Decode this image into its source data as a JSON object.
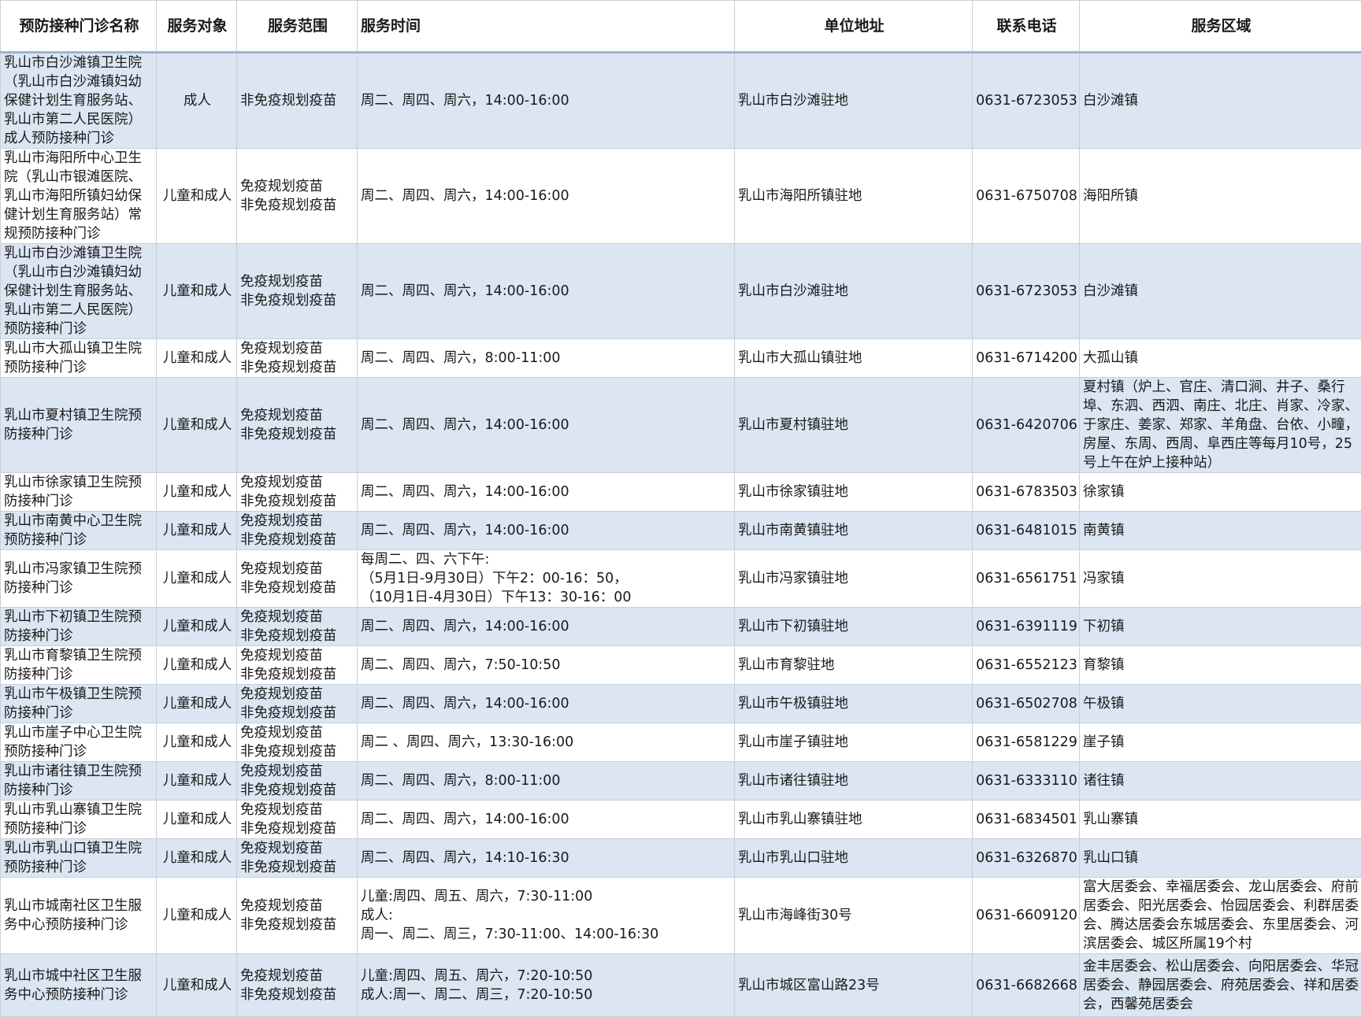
{
  "headers": {
    "name": "预防接种门诊名称",
    "target": "服务对象",
    "scope": "服务范围",
    "time": "服务时间",
    "address": "单位地址",
    "phone": "联系电话",
    "area": "服务区域"
  },
  "rows": [
    {
      "name": "乳山市白沙滩镇卫生院（乳山市白沙滩镇妇幼保健计划生育服务站、乳山市第二人民医院）成人预防接种门诊",
      "target": "成人",
      "scope": "非免疫规划疫苗",
      "time": "周二、周四、周六，14:00-16:00",
      "address": "乳山市白沙滩驻地",
      "phone": "0631-6723053",
      "area": "白沙滩镇"
    },
    {
      "name": "乳山市海阳所中心卫生院（乳山市银滩医院、乳山市海阳所镇妇幼保健计划生育服务站）常规预防接种门诊",
      "target": "儿童和成人",
      "scope": "免疫规划疫苗\n非免疫规划疫苗",
      "time": "周二、周四、周六，14:00-16:00",
      "address": "乳山市海阳所镇驻地",
      "phone": "0631-6750708",
      "area": "海阳所镇"
    },
    {
      "name": "乳山市白沙滩镇卫生院（乳山市白沙滩镇妇幼保健计划生育服务站、乳山市第二人民医院）预防接种门诊",
      "target": "儿童和成人",
      "scope": "免疫规划疫苗\n非免疫规划疫苗",
      "time": "周二、周四、周六，14:00-16:00",
      "address": "乳山市白沙滩驻地",
      "phone": "0631-6723053",
      "area": "白沙滩镇"
    },
    {
      "name": "乳山市大孤山镇卫生院预防接种门诊",
      "target": "儿童和成人",
      "scope": "免疫规划疫苗\n非免疫规划疫苗",
      "time": "周二、周四、周六，8:00-11:00",
      "address": "乳山市大孤山镇驻地",
      "phone": "0631-6714200",
      "area": "大孤山镇"
    },
    {
      "name": "乳山市夏村镇卫生院预防接种门诊",
      "target": "儿童和成人",
      "scope": "免疫规划疫苗\n非免疫规划疫苗",
      "time": "周二、周四、周六，14:00-16:00",
      "address": "乳山市夏村镇驻地",
      "phone": "0631-6420706",
      "area": "夏村镇（炉上、官庄、清口涧、井子、桑行埠、东泗、西泗、南庄、北庄、肖家、冷家、于家庄、姜家、郑家、羊角盘、台依、小疃，房屋、东周、西周、阜西庄等每月10号，25号上午在炉上接种站）"
    },
    {
      "name": "乳山市徐家镇卫生院预防接种门诊",
      "target": "儿童和成人",
      "scope": "免疫规划疫苗\n非免疫规划疫苗",
      "time": "周二、周四、周六，14:00-16:00",
      "address": "乳山市徐家镇驻地",
      "phone": "0631-6783503",
      "area": "徐家镇"
    },
    {
      "name": "乳山市南黄中心卫生院预防接种门诊",
      "target": "儿童和成人",
      "scope": "免疫规划疫苗\n非免疫规划疫苗",
      "time": "周二、周四、周六，14:00-16:00",
      "address": "乳山市南黄镇驻地",
      "phone": "0631-6481015",
      "area": "南黄镇"
    },
    {
      "name": "乳山市冯家镇卫生院预防接种门诊",
      "target": "儿童和成人",
      "scope": "免疫规划疫苗\n非免疫规划疫苗",
      "time": "每周二、四、六下午:\n（5月1日-9月30日）下午2：00-16：50，\n（10月1日-4月30日）下午13：30-16：00",
      "address": "乳山市冯家镇驻地",
      "phone": "0631-6561751",
      "area": "冯家镇"
    },
    {
      "name": "乳山市下初镇卫生院预防接种门诊",
      "target": "儿童和成人",
      "scope": "免疫规划疫苗\n非免疫规划疫苗",
      "time": "周二、周四、周六，14:00-16:00",
      "address": "乳山市下初镇驻地",
      "phone": "0631-6391119",
      "area": "下初镇"
    },
    {
      "name": "乳山市育黎镇卫生院预防接种门诊",
      "target": "儿童和成人",
      "scope": "免疫规划疫苗\n非免疫规划疫苗",
      "time": "周二、周四、周六，7:50-10:50",
      "address": "乳山市育黎驻地",
      "phone": "0631-6552123",
      "area": "育黎镇"
    },
    {
      "name": "乳山市午极镇卫生院预防接种门诊",
      "target": "儿童和成人",
      "scope": "免疫规划疫苗\n非免疫规划疫苗",
      "time": "周二、周四、周六，14:00-16:00",
      "address": "乳山市午极镇驻地",
      "phone": "0631-6502708",
      "area": "午极镇"
    },
    {
      "name": "乳山市崖子中心卫生院预防接种门诊",
      "target": "儿童和成人",
      "scope": "免疫规划疫苗\n非免疫规划疫苗",
      "time": "周二 、周四、周六，13:30-16:00",
      "address": "乳山市崖子镇驻地",
      "phone": "0631-6581229",
      "area": "崖子镇"
    },
    {
      "name": "乳山市诸往镇卫生院预防接种门诊",
      "target": "儿童和成人",
      "scope": "免疫规划疫苗\n非免疫规划疫苗",
      "time": "周二、周四、周六，8:00-11:00",
      "address": "乳山市诸往镇驻地",
      "phone": "0631-6333110",
      "area": "诸往镇"
    },
    {
      "name": "乳山市乳山寨镇卫生院预防接种门诊",
      "target": "儿童和成人",
      "scope": "免疫规划疫苗\n非免疫规划疫苗",
      "time": "周二、周四、周六，14:00-16:00",
      "address": "乳山市乳山寨镇驻地",
      "phone": "0631-6834501",
      "area": "乳山寨镇"
    },
    {
      "name": "乳山市乳山口镇卫生院预防接种门诊",
      "target": "儿童和成人",
      "scope": "免疫规划疫苗\n非免疫规划疫苗",
      "time": "周二、周四、周六，14:10-16:30",
      "address": "乳山市乳山口驻地",
      "phone": "0631-6326870",
      "area": "乳山口镇"
    },
    {
      "name": "乳山市城南社区卫生服务中心预防接种门诊",
      "target": "儿童和成人",
      "scope": "免疫规划疫苗\n非免疫规划疫苗",
      "time": "儿童:周四、周五、周六，7:30-11:00\n成人:\n周一、周二、周三，7:30-11:00、14:00-16:30",
      "address": "乳山市海峰街30号",
      "phone": "0631-6609120",
      "area": "富大居委会、幸福居委会、龙山居委会、府前居委会、阳光居委会、怡园居委会、利群居委会、腾达居委会东城居委会、东里居委会、河滨居委会、城区所属19个村"
    },
    {
      "name": "乳山市城中社区卫生服务中心预防接种门诊",
      "target": "儿童和成人",
      "scope": "免疫规划疫苗\n非免疫规划疫苗",
      "time": "儿童:周四、周五、周六，7:20-10:50\n成人:周一、周二、周三，7:20-10:50",
      "address": "乳山市城区富山路23号",
      "phone": "0631-6682668",
      "area": "金丰居委会、松山居委会、向阳居委会、华冠居委会、静园居委会、府苑居委会、祥和居委会，西馨苑居委会"
    }
  ]
}
